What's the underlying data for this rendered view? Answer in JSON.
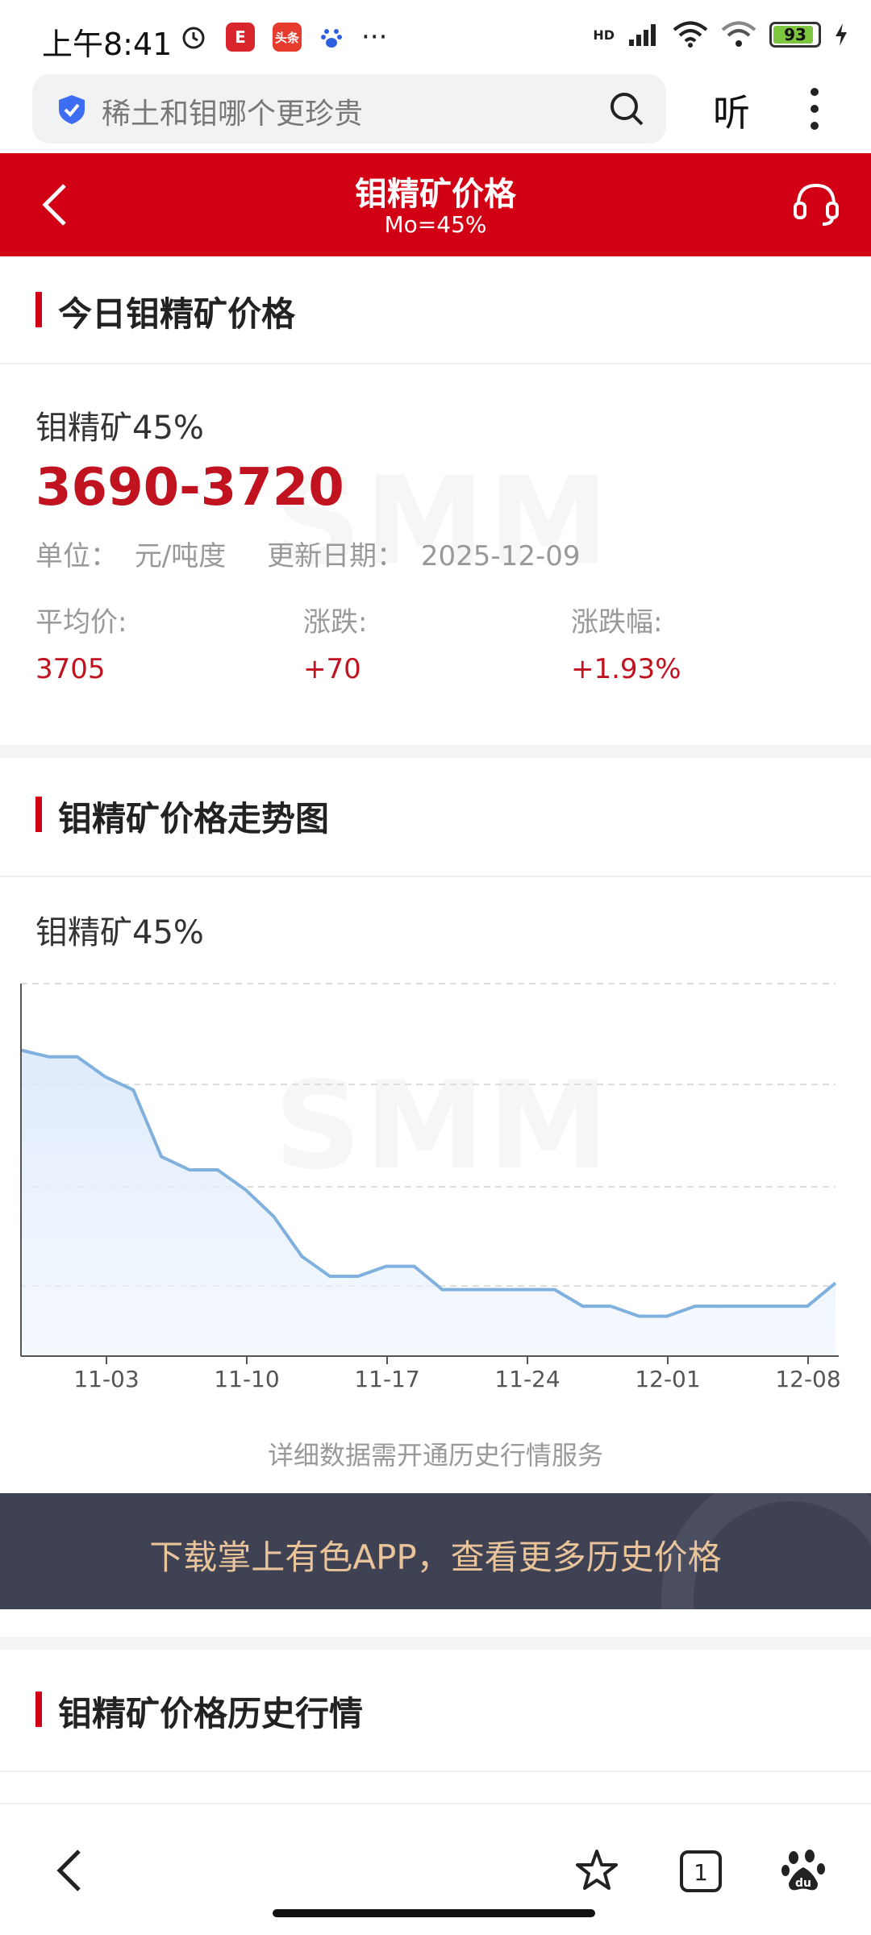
{
  "status_bar": {
    "time": "上午8:41",
    "app_icons": [
      "alarm-icon",
      "E",
      "头条",
      "baidu-icon"
    ],
    "more": "···",
    "network": "HD",
    "battery": "93"
  },
  "browser": {
    "search_query": "稀土和钼哪个更珍贵",
    "listen_label": "听"
  },
  "header": {
    "title": "钼精矿价格",
    "subtitle": "Mo=45%"
  },
  "today": {
    "section_title": "今日钼精矿价格",
    "product": "钼精矿45%",
    "price_range": "3690-3720",
    "unit_label": "单位：",
    "unit_value": "元/吨度",
    "date_label": "更新日期：",
    "date_value": "2025-12-09",
    "avg_label": "平均价:",
    "avg_value": "3705",
    "change_label": "涨跌:",
    "change_value": "+70",
    "pct_label": "涨跌幅:",
    "pct_value": "+1.93%"
  },
  "trend": {
    "section_title": "钼精矿价格走势图",
    "chart_title": "钼精矿45%",
    "note": "详细数据需开通历史行情服务"
  },
  "chart_data": {
    "type": "area",
    "title": "钼精矿45%",
    "x_tick_labels": [
      "11-03",
      "11-10",
      "11-17",
      "11-24",
      "12-01",
      "12-08"
    ],
    "values": [
      4020,
      4010,
      4010,
      3980,
      3960,
      3860,
      3840,
      3840,
      3810,
      3770,
      3710,
      3680,
      3680,
      3695,
      3695,
      3660,
      3660,
      3660,
      3660,
      3660,
      3635,
      3635,
      3620,
      3620,
      3635,
      3635,
      3635,
      3635,
      3635,
      3670
    ],
    "ylim": [
      3560,
      4120
    ],
    "grid": "horizontal dashed",
    "color": "#7fb0de"
  },
  "banner": {
    "text": "下载掌上有色APP，查看更多历史价格"
  },
  "history": {
    "section_title": "钼精矿价格历史行情"
  },
  "watermark": "SMM",
  "colors": {
    "brand_red": "#d20014",
    "price_red": "#c0121f",
    "banner_bg": "#3f4253",
    "banner_text": "#e9c39a"
  }
}
